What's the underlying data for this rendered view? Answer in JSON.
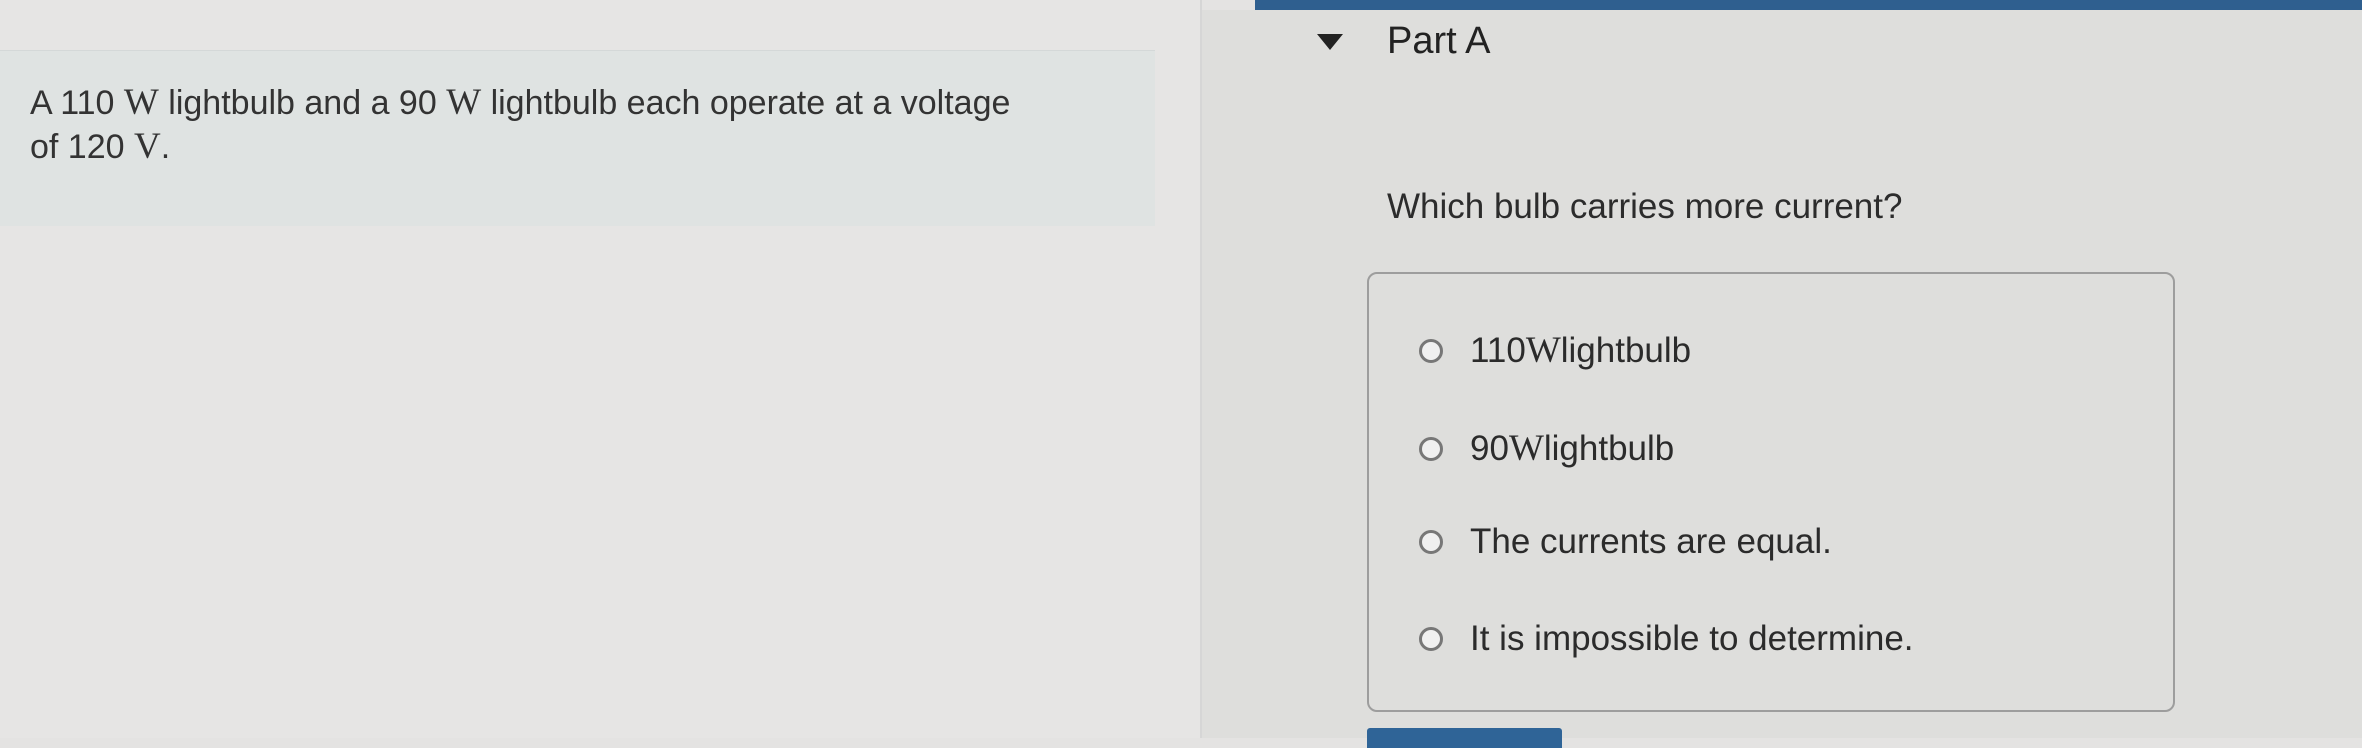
{
  "left": {
    "question": {
      "prefix": "A 110 ",
      "unit_w1": "W",
      "middle": " lightbulb and a 90 ",
      "unit_w2": "W",
      "suffix": " lightbulb each operate at a voltage",
      "line2_prefix": "of 120 ",
      "unit_v": "V",
      "line2_suffix": "."
    }
  },
  "part": {
    "title": "Part A",
    "prompt": "Which bulb carries more current?"
  },
  "options": [
    {
      "number": "110 ",
      "unit": "W",
      "label": " lightbulb"
    },
    {
      "label": "90 ",
      "unit": "W",
      "tail": " lightbulb"
    },
    {
      "label": "The currents are equal."
    },
    {
      "label": "It is impossible to determine."
    }
  ],
  "colors": {
    "accent": "#2f6497"
  }
}
